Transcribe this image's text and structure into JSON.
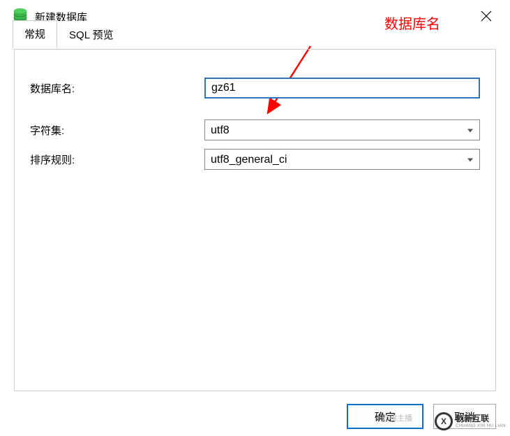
{
  "title_bar": {
    "title": "新建数据库"
  },
  "tabs": {
    "general": "常规",
    "sql_preview": "SQL 预览"
  },
  "form": {
    "db_name_label": "数据库名:",
    "db_name_value": "gz61",
    "charset_label": "字符集:",
    "charset_value": "utf8",
    "collation_label": "排序规则:",
    "collation_value": "utf8_general_ci"
  },
  "annotation": {
    "text": "数据库名"
  },
  "buttons": {
    "ok": "确定",
    "cancel": "取消"
  },
  "watermarks": {
    "small": "@稀主播",
    "brand": "创新互联",
    "brand_sub": "CHUANG XIN HU LIAN"
  }
}
